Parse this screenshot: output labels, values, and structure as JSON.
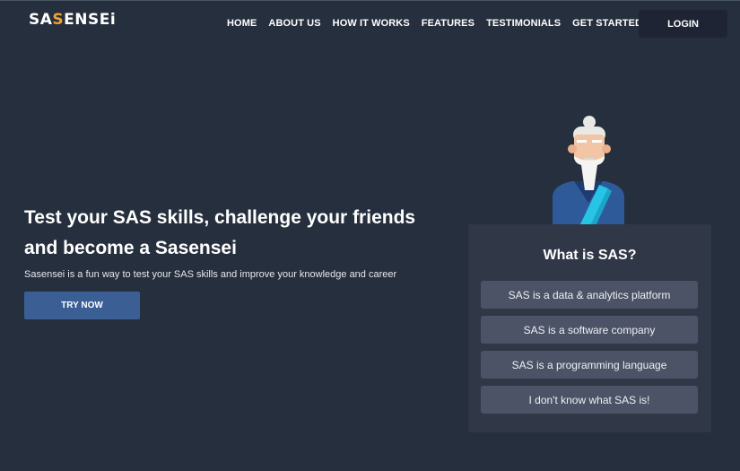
{
  "brand": {
    "logo_prefix": "SA",
    "logo_accent": "S",
    "logo_suffix": "ENSEi",
    "accent_color": "#f0a23a"
  },
  "nav": {
    "links": [
      "HOME",
      "ABOUT US",
      "HOW IT WORKS",
      "FEATURES",
      "TESTIMONIALS",
      "GET STARTED"
    ],
    "login_label": "LOGIN"
  },
  "hero": {
    "title_line1": "Test your SAS skills, challenge your friends",
    "title_line2": "and become a Sasensei",
    "subtitle": "Sasensei is a fun way to test your SAS skills and improve your knowledge and career",
    "cta_label": "TRY NOW",
    "cta_color": "#3b5f95"
  },
  "mascot": {
    "icon": "sensei-mascot-icon"
  },
  "quiz": {
    "question": "What is SAS?",
    "options": [
      "SAS is a data & analytics platform",
      "SAS is a software company",
      "SAS is a programming language",
      "I don't know what SAS is!"
    ]
  },
  "colors": {
    "background": "#262f3d",
    "card": "#303746",
    "option": "#4c5366",
    "login_button": "#1e2433"
  }
}
